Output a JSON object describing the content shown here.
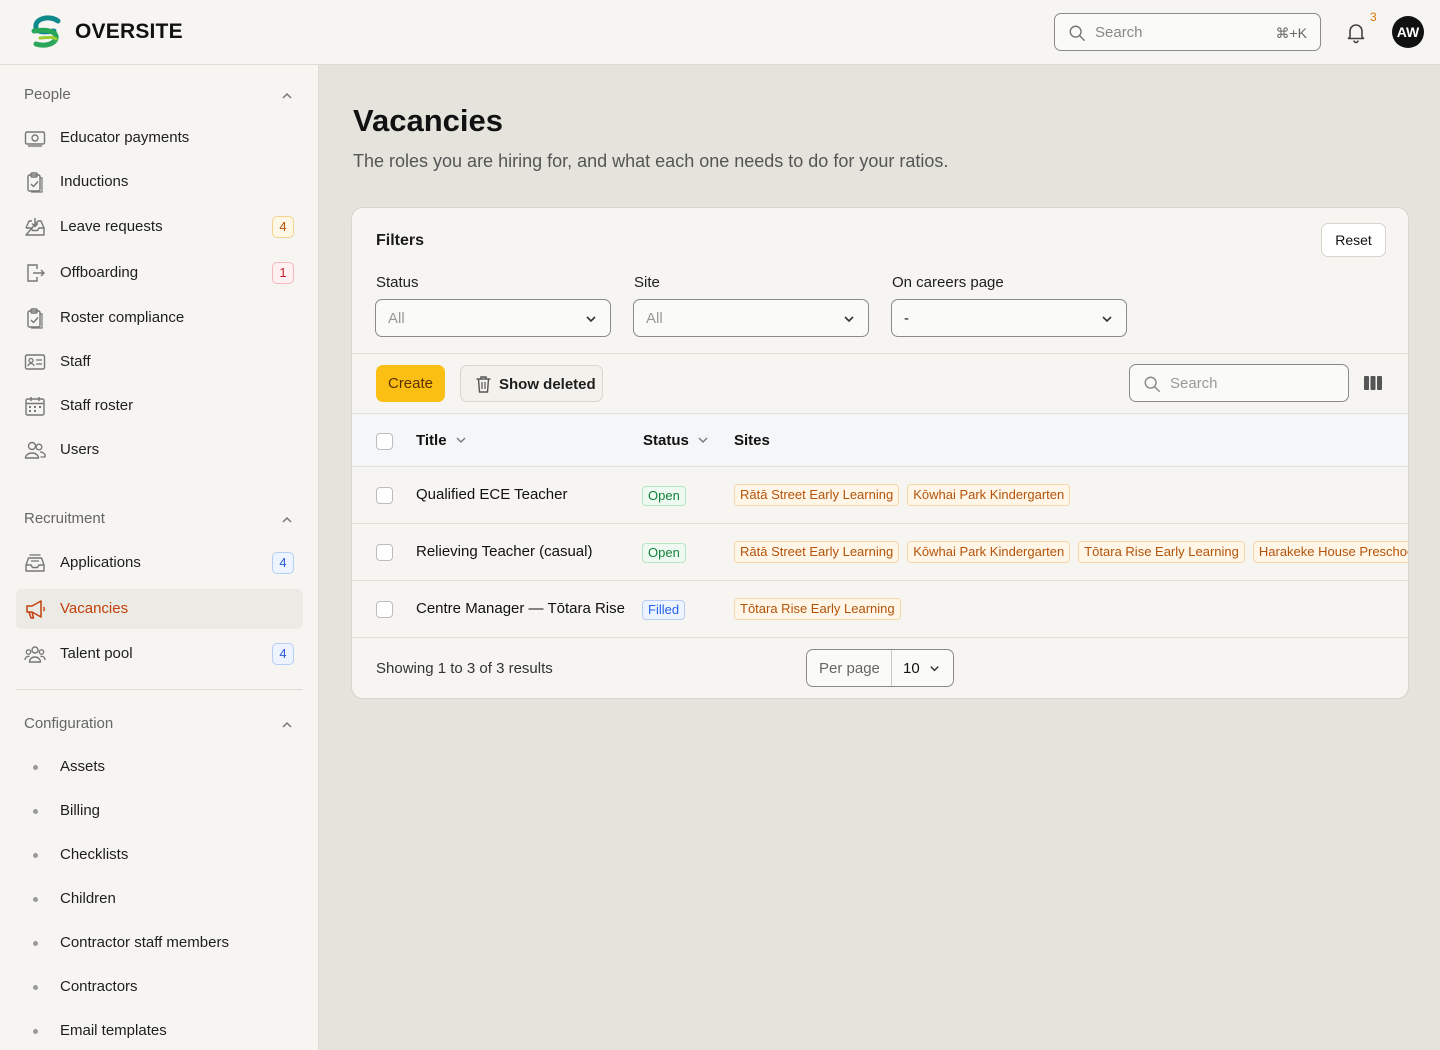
{
  "app": {
    "brand": "OVERSITE"
  },
  "header": {
    "search_placeholder": "Search",
    "search_shortcut": "⌘+K",
    "notification_count": "3",
    "avatar_initials": "AW"
  },
  "sidebar": {
    "sections": [
      {
        "title": "People",
        "items": [
          {
            "label": "Educator payments",
            "icon": "payments-icon"
          },
          {
            "label": "Inductions",
            "icon": "clipboard-check-icon"
          },
          {
            "label": "Leave requests",
            "icon": "inbox-download-icon",
            "badge": "4"
          },
          {
            "label": "Offboarding",
            "icon": "exit-door-icon",
            "badge": "1"
          },
          {
            "label": "Roster compliance",
            "icon": "clipboard-check-icon"
          },
          {
            "label": "Staff",
            "icon": "id-card-icon"
          },
          {
            "label": "Staff roster",
            "icon": "calendar-icon"
          },
          {
            "label": "Users",
            "icon": "users-icon"
          }
        ]
      },
      {
        "title": "Recruitment",
        "items": [
          {
            "label": "Applications",
            "icon": "inbox-stack-icon",
            "badge": "4"
          },
          {
            "label": "Vacancies",
            "icon": "megaphone-icon",
            "active": true
          },
          {
            "label": "Talent pool",
            "icon": "user-group-icon",
            "badge": "4"
          }
        ]
      },
      {
        "title": "Configuration",
        "items": [
          {
            "label": "Assets"
          },
          {
            "label": "Billing"
          },
          {
            "label": "Checklists"
          },
          {
            "label": "Children"
          },
          {
            "label": "Contractor staff members"
          },
          {
            "label": "Contractors"
          },
          {
            "label": "Email templates"
          }
        ]
      }
    ]
  },
  "page": {
    "title": "Vacancies",
    "subtitle": "The roles you are hiring for, and what each one needs to do for your ratios."
  },
  "filters": {
    "title": "Filters",
    "reset_label": "Reset",
    "fields": [
      {
        "label": "Status",
        "value": "All"
      },
      {
        "label": "Site",
        "value": "All"
      },
      {
        "label": "On careers page",
        "value": "-"
      }
    ]
  },
  "toolbar": {
    "create_label": "Create",
    "show_deleted_label": "Show deleted",
    "search_placeholder": "Search"
  },
  "table": {
    "columns": [
      "Title",
      "Status",
      "Sites"
    ],
    "rows": [
      {
        "title": "Qualified ECE Teacher",
        "status": "Open",
        "sites": [
          "Rātā Street Early Learning",
          "Kōwhai Park Kindergarten"
        ]
      },
      {
        "title": "Relieving Teacher (casual)",
        "status": "Open",
        "sites": [
          "Rātā Street Early Learning",
          "Kōwhai Park Kindergarten",
          "Tōtara Rise Early Learning",
          "Harakeke House Preschool"
        ]
      },
      {
        "title": "Centre Manager — Tōtara Rise",
        "status": "Filled",
        "sites": [
          "Tōtara Rise Early Learning"
        ]
      }
    ]
  },
  "pagination": {
    "summary": "Showing 1 to 3 of 3 results",
    "per_page_label": "Per page",
    "per_page_value": "10"
  },
  "colors": {
    "accent": "#c2410c",
    "create_button": "#fbbf14",
    "open_status": "#15803d",
    "filled_status": "#2563eb"
  }
}
